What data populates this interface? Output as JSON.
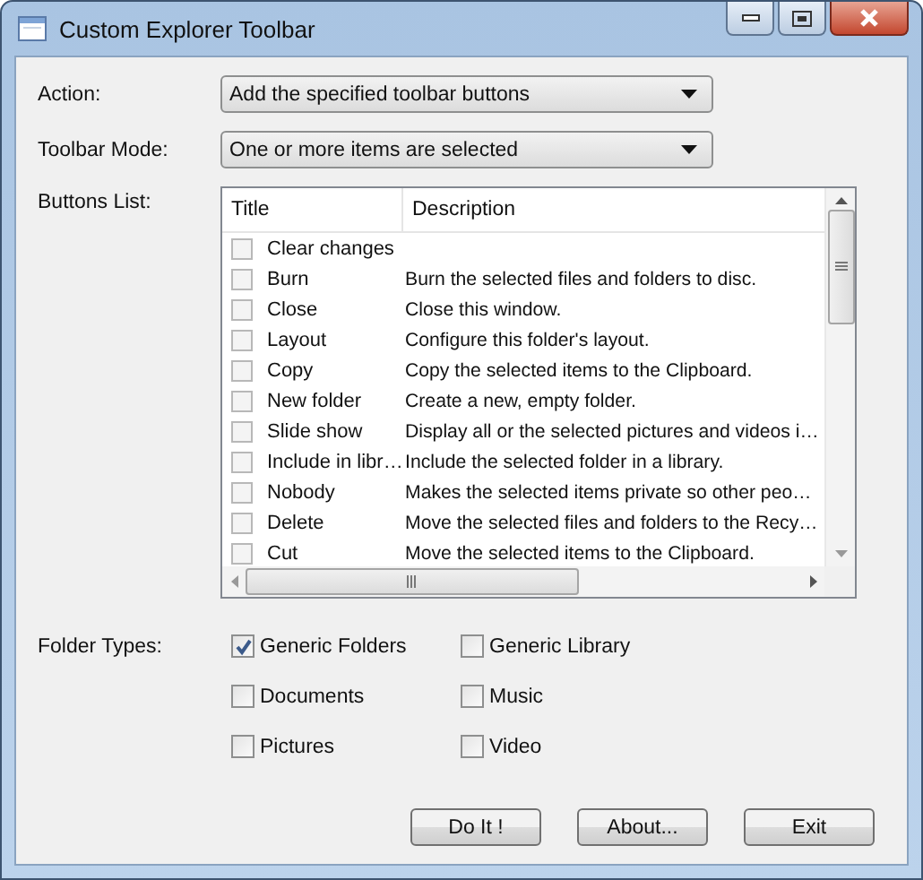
{
  "window": {
    "title": "Custom Explorer Toolbar"
  },
  "action": {
    "label": "Action:",
    "value": "Add the specified toolbar buttons"
  },
  "toolbar_mode": {
    "label": "Toolbar Mode:",
    "value": "One or more items are selected"
  },
  "buttons_list": {
    "label": "Buttons List:",
    "columns": [
      "Title",
      "Description"
    ],
    "rows": [
      {
        "title": "Clear changes",
        "description": "",
        "checked": false
      },
      {
        "title": "Burn",
        "description": "Burn the selected files and folders to disc.",
        "checked": false
      },
      {
        "title": "Close",
        "description": "Close this window.",
        "checked": false
      },
      {
        "title": "Layout",
        "description": "Configure this folder's layout.",
        "checked": false
      },
      {
        "title": "Copy",
        "description": "Copy the selected items to the Clipboard.",
        "checked": false
      },
      {
        "title": "New folder",
        "description": "Create a new, empty folder.",
        "checked": false
      },
      {
        "title": "Slide show",
        "description": "Display all or the selected pictures and videos i…",
        "checked": false
      },
      {
        "title": "Include in libr…",
        "description": "Include the selected folder in a library.",
        "checked": false
      },
      {
        "title": "Nobody",
        "description": "Makes the selected items private so other peo…",
        "checked": false
      },
      {
        "title": "Delete",
        "description": "Move the selected files and folders to the Recy…",
        "checked": false
      },
      {
        "title": "Cut",
        "description": "Move the selected items to the Clipboard.",
        "checked": false
      }
    ]
  },
  "folder_types": {
    "label": "Folder Types:",
    "options": [
      {
        "label": "Generic Folders",
        "checked": true
      },
      {
        "label": "Generic Library",
        "checked": false
      },
      {
        "label": "Documents",
        "checked": false
      },
      {
        "label": "Music",
        "checked": false
      },
      {
        "label": "Pictures",
        "checked": false
      },
      {
        "label": "Video",
        "checked": false
      }
    ]
  },
  "buttons": [
    "Do It !",
    "About...",
    "Exit"
  ]
}
